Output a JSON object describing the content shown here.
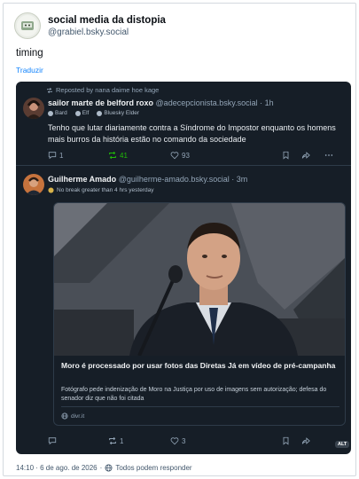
{
  "post": {
    "author_name": "social media da distopia",
    "author_handle": "@grabiel.bsky.social",
    "text": "timing",
    "translate_label": "Traduzir",
    "footer_time": "14:10 · 6 de ago. de 2026",
    "footer_reply": "Todos podem responder"
  },
  "reposted": {
    "label": "Reposted by nana daime hoe kage",
    "name": "sailor marte de belford roxo",
    "handle": "@adecepcionista.bsky.social",
    "time": "· 1h",
    "badges": [
      "Bard",
      "Elf",
      "Bluesky Elder"
    ],
    "text": "Tenho que lutar diariamente contra a Síndrome do Impostor enquanto os homens mais burros da história estão no comando da sociedade",
    "reply_count": "1",
    "repost_count": "41",
    "like_count": "93"
  },
  "quoted": {
    "name": "Guilherme Amado",
    "handle": "@guilherme-amado.bsky.social",
    "time": "· 3m",
    "status": "No break greater than 4 hrs yesterday",
    "embed_title": "Moro é processado por usar fotos das Diretas Já em vídeo de pré-campanha",
    "embed_desc": "Fotógrafo pede indenização de Moro na Justiça por uso de imagens sem autorização; defesa do senador diz que não foi citada",
    "embed_domain": "divr.it",
    "reply_count": "",
    "repost_count": "1",
    "like_count": "3",
    "alt_label": "ALT"
  },
  "colors": {
    "card_bg": "#161e27",
    "repost_green": "#20bc07",
    "link_blue": "#1083fe"
  }
}
